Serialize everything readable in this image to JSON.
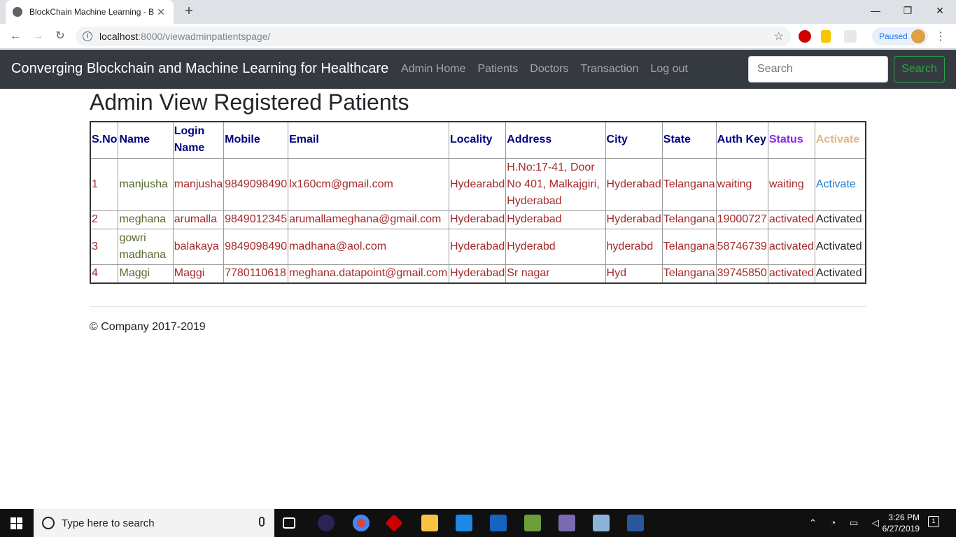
{
  "browser": {
    "tab_title": "BlockChain Machine Learning - B",
    "url_host": "localhost",
    "url_path": ":8000/viewadminpatientspage/",
    "profile_status": "Paused"
  },
  "navbar": {
    "brand": "Converging Blockchain and Machine Learning for Healthcare",
    "links": [
      "Admin Home",
      "Patients",
      "Doctors",
      "Transaction",
      "Log out"
    ],
    "search_placeholder": "Search",
    "search_button": "Search"
  },
  "page": {
    "heading": "Admin View Registered Patients",
    "footer": "© Company 2017-2019"
  },
  "table": {
    "headers": [
      "S.No",
      "Name",
      "Login Name",
      "Mobile",
      "Email",
      "Locality",
      "Address",
      "City",
      "State",
      "Auth Key",
      "Status",
      "Activate"
    ],
    "rows": [
      {
        "sno": "1",
        "name": "manjusha",
        "login": "manjusha",
        "mobile": "9849098490",
        "email": "lx160cm@gmail.com",
        "locality": "Hydearabd",
        "address": "H.No:17-41, Door No 401, Malkajgiri, Hyderabad",
        "city": "Hyderabad",
        "state": "Telangana",
        "authkey": "waiting",
        "status": "waiting",
        "activate": "Activate"
      },
      {
        "sno": "2",
        "name": "meghana",
        "login": "arumalla",
        "mobile": "9849012345",
        "email": "arumallameghana@gmail.com",
        "locality": "Hyderabad",
        "address": "Hyderabad",
        "city": "Hyderabad",
        "state": "Telangana",
        "authkey": "19000727",
        "status": "activated",
        "activate": "Activated"
      },
      {
        "sno": "3",
        "name": "gowri madhana",
        "login": "balakaya",
        "mobile": "9849098490",
        "email": "madhana@aol.com",
        "locality": "Hyderabad",
        "address": "Hyderabd",
        "city": "hyderabd",
        "state": "Telangana",
        "authkey": "58746739",
        "status": "activated",
        "activate": "Activated"
      },
      {
        "sno": "4",
        "name": "Maggi",
        "login": "Maggi",
        "mobile": "7780110618",
        "email": "meghana.datapoint@gmail.com",
        "locality": "Hyderabad",
        "address": "Sr nagar",
        "city": "Hyd",
        "state": "Telangana",
        "authkey": "39745850",
        "status": "activated",
        "activate": "Activated"
      }
    ]
  },
  "taskbar": {
    "search_placeholder": "Type here to search",
    "time": "3:26 PM",
    "date": "6/27/2019"
  }
}
